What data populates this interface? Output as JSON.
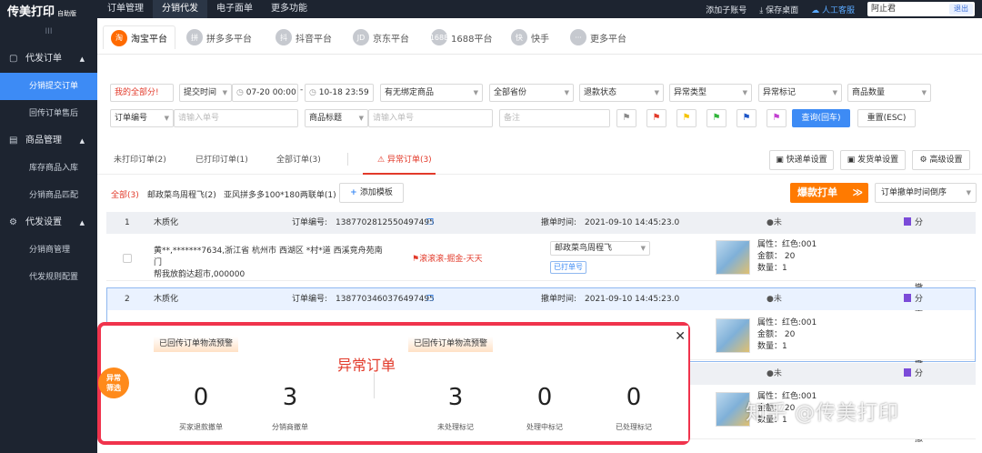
{
  "app": {
    "logo": "传美打印",
    "edition": "自助版"
  },
  "topnav": {
    "items": [
      "订单管理",
      "分销代发",
      "电子面单",
      "更多功能"
    ],
    "active": 1
  },
  "topright": {
    "add_sub": "添加子账号",
    "save_desktop": "保存桌面",
    "service": "人工客服",
    "user": "阿止君",
    "logout": "退出"
  },
  "sidebar": {
    "collapse": "III",
    "groups": [
      {
        "label": "代发订单",
        "items": [
          "分销提交订单",
          "回传订单售后"
        ]
      },
      {
        "label": "商品管理",
        "items": [
          "库存商品入库",
          "分销商品匹配"
        ]
      },
      {
        "label": "代发设置",
        "items": [
          "分销商管理",
          "代发规则配置"
        ]
      }
    ]
  },
  "platforms": [
    "淘宝平台",
    "拼多多平台",
    "抖音平台",
    "京东平台",
    "1688平台",
    "快手",
    "更多平台"
  ],
  "platform_icons": [
    "淘",
    "拼",
    "抖",
    "JD",
    "1688",
    "快",
    "···"
  ],
  "filters": {
    "my_orders": "我的全部分!",
    "time_type": "提交时间",
    "date_from": "07-20 00:00",
    "date_to": "10-18 23:59",
    "bind": "有无绑定商品",
    "province": "全部省份",
    "refund": "退款状态",
    "abnormal_type": "异常类型",
    "abnormal_mark": "异常标记",
    "qty": "商品数量",
    "order_no_sel": "订单编号",
    "order_no_ph": "请输入单号",
    "title_sel": "商品标题",
    "title_ph": "请输入单号",
    "remark_ph": "备注",
    "query": "查询(回车)",
    "reset": "重置(ESC)"
  },
  "flag_colors": [
    "#888888",
    "#e23a2a",
    "#f5c400",
    "#31b53a",
    "#1e56c8",
    "#c23fd1"
  ],
  "order_tabs": {
    "not_printed": "未打印订单(2)",
    "printed": "已打印订单(1)",
    "all": "全部订单(3)",
    "abnormal": "异常订单(3)"
  },
  "settings": {
    "express": "快递单设置",
    "delivery": "发货单设置",
    "advanced": "高级设置"
  },
  "templates": {
    "all": "全部(3)",
    "t1": "邮政菜鸟周程飞(2)",
    "t2": "亚风拼多多100*180两联单(1)",
    "add": "添加模板"
  },
  "hot": "爆款打单",
  "sort": "订单撤单时间倒序",
  "orders": [
    {
      "idx": "1",
      "shop": "木质化",
      "no_label": "订单编号:",
      "no": "1387702812550497495",
      "time_label": "撤单时间:",
      "time": "2021-09-10 14:45:23.0",
      "status": "未处理",
      "tag": "分销商撤单",
      "addr1": "黄**,*******7634,浙江省 杭州市 西湖区 *村*道 西溪竞舟苑南门",
      "addr2": "帮我放韵达超市,000000",
      "flag_text": "滚滚滚-掘金-天天",
      "express": "邮政菜鸟周程飞",
      "printed": "已打单号",
      "attr_color": "属性：红色:001",
      "attr_amount": "金额：  20",
      "attr_qty": "数量：1"
    },
    {
      "idx": "2",
      "shop": "木质化",
      "no_label": "订单编号:",
      "no": "1387703460376497495",
      "time_label": "撤单时间:",
      "time": "2021-09-10 14:45:23.0",
      "status": "未处理",
      "tag": "分销商撤单",
      "attr_color": "属性：红色:001",
      "attr_amount": "金额：  20",
      "attr_qty": "数量：1"
    },
    {
      "status": "未处理",
      "tag": "分销商撤单",
      "attr_color": "属性：红色:001",
      "attr_amount": "金额：  20",
      "attr_qty": "数量：1"
    }
  ],
  "popup": {
    "tag_left": "已回传订单物流预警",
    "tag_right": "已回传订单物流预警",
    "title": "异常订单",
    "stats": [
      {
        "n": "0",
        "l": "买家退款撤单"
      },
      {
        "n": "3",
        "l": "分销商撤单"
      },
      {
        "n": "3",
        "l": "未处理标记"
      },
      {
        "n": "0",
        "l": "处理中标记"
      },
      {
        "n": "0",
        "l": "已处理标记"
      }
    ],
    "badge": "异常筛选"
  },
  "watermark": "知乎 @传美打印"
}
